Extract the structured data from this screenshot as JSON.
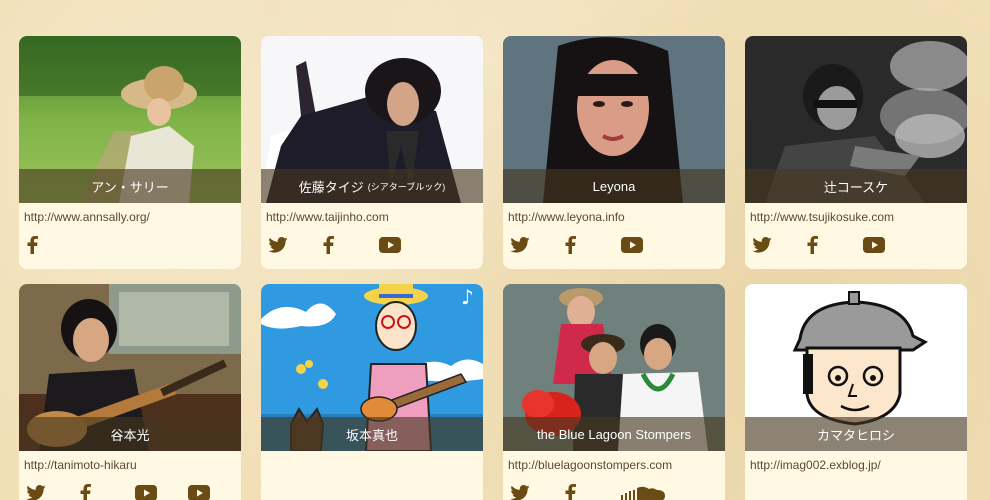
{
  "colors": {
    "icon": "#6b4b14",
    "name_bar": "rgba(70,55,30,0.62)",
    "card_bg": "#fff8e2",
    "page_bg": "#f1dfb6"
  },
  "artists": [
    {
      "name": "アン・サリー",
      "sub": "",
      "url": "http://www.annsally.org/",
      "icons": [
        "facebook-icon"
      ]
    },
    {
      "name": "佐藤タイジ",
      "sub": "(シアターブルック)",
      "url": "http://www.taijinho.com",
      "icons": [
        "twitter-icon",
        "facebook-icon",
        "youtube-icon"
      ]
    },
    {
      "name": "Leyona",
      "sub": "",
      "url": "http://www.leyona.info",
      "icons": [
        "twitter-icon",
        "facebook-icon",
        "youtube-icon"
      ]
    },
    {
      "name": "辻コースケ",
      "sub": "",
      "url": "http://www.tsujikosuke.com",
      "icons": [
        "twitter-icon",
        "facebook-icon",
        "youtube-icon"
      ]
    },
    {
      "name": "谷本光",
      "sub": "",
      "url": "http://tanimoto-hikaru",
      "icons": [
        "twitter-icon",
        "facebook-icon",
        "youtube-icon",
        "youtube-icon"
      ]
    },
    {
      "name": "坂本真也",
      "sub": "",
      "url": "",
      "icons": []
    },
    {
      "name": "the Blue Lagoon Stompers",
      "sub": "",
      "url": "http://bluelagoonstompers.com",
      "icons": [
        "twitter-icon",
        "facebook-icon",
        "soundcloud-icon"
      ]
    },
    {
      "name": "カマタヒロシ",
      "sub": "",
      "url": "http://imag002.exblog.jp/",
      "icons": []
    }
  ]
}
